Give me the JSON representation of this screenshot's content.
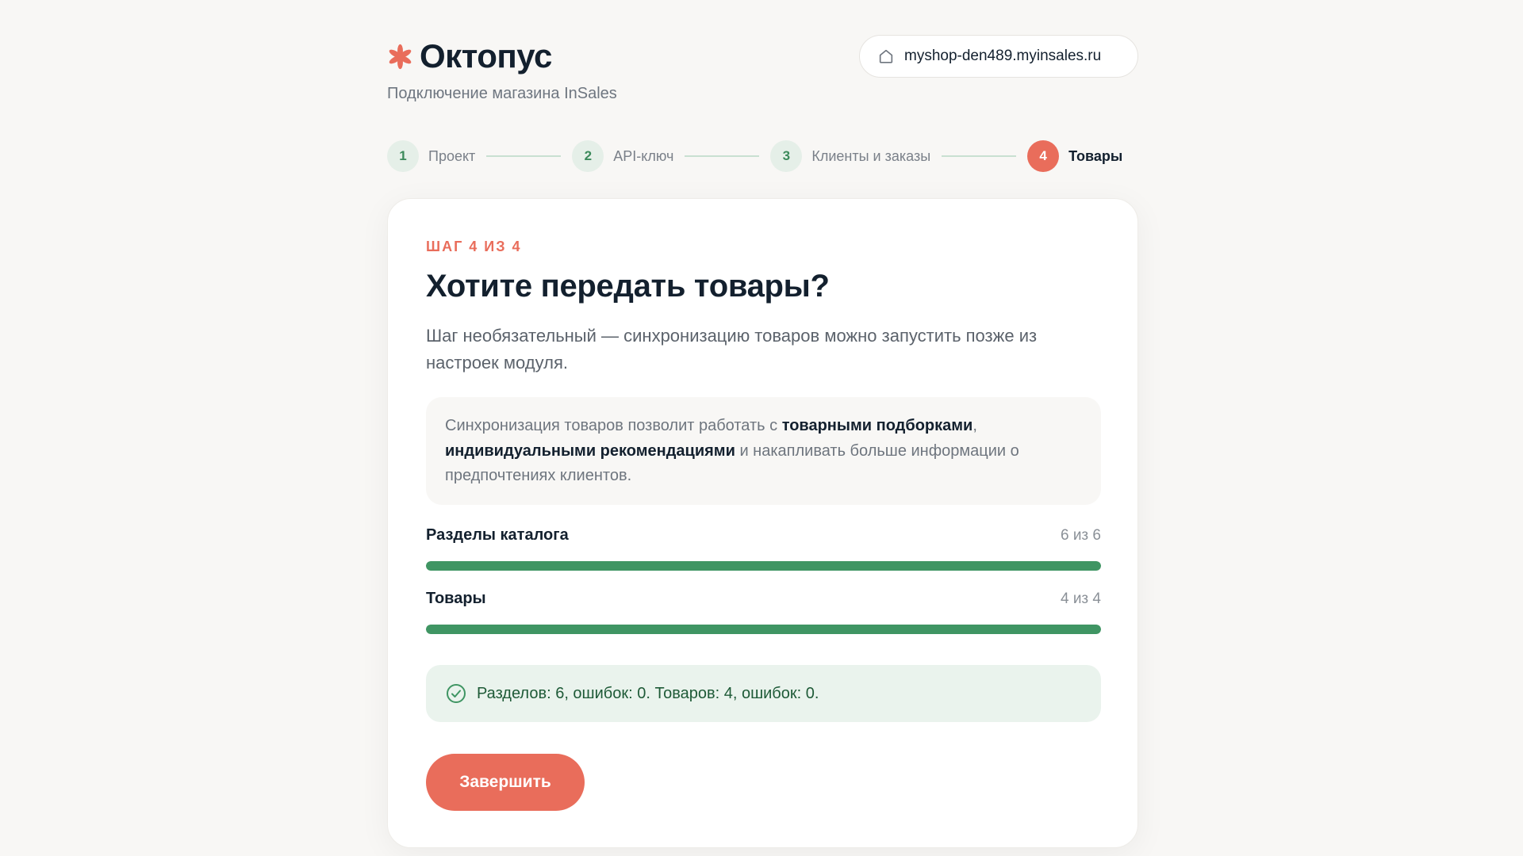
{
  "brand": {
    "name": "Октопус",
    "logo_icon": "asterisk-flower-icon",
    "accent": "#e96d5b"
  },
  "subtitle": "Подключение магазина InSales",
  "shop": {
    "icon": "home-icon",
    "url": "myshop-den489.myinsales.ru"
  },
  "steps": [
    {
      "num": "1",
      "label": "Проект",
      "state": "done"
    },
    {
      "num": "2",
      "label": "API-ключ",
      "state": "done"
    },
    {
      "num": "3",
      "label": "Клиенты и заказы",
      "state": "done"
    },
    {
      "num": "4",
      "label": "Товары",
      "state": "active"
    }
  ],
  "card": {
    "eyebrow": "ШАГ 4 ИЗ 4",
    "title": "Хотите передать товары?",
    "lead": "Шаг необязательный — синхронизацию товаров можно запустить позже из настроек модуля.",
    "info": {
      "part1": "Синхронизация товаров позволит работать с ",
      "bold1": "товарными подборками",
      "part2": ", ",
      "bold2": "индивидуальными рекомендациями",
      "part3": " и накапливать больше информации о предпочтениях клиентов."
    },
    "progress": [
      {
        "label": "Разделы каталога",
        "count": "6 из 6",
        "done": 6,
        "total": 6
      },
      {
        "label": "Товары",
        "count": "4 из 4",
        "done": 4,
        "total": 4
      }
    ],
    "result": {
      "icon": "check-circle-icon",
      "text": "Разделов: 6, ошибок: 0. Товаров: 4, ошибок: 0."
    },
    "finish_label": "Завершить"
  },
  "colors": {
    "success": "#3f9563",
    "accent": "#e96d5b",
    "ink": "#13202e"
  }
}
